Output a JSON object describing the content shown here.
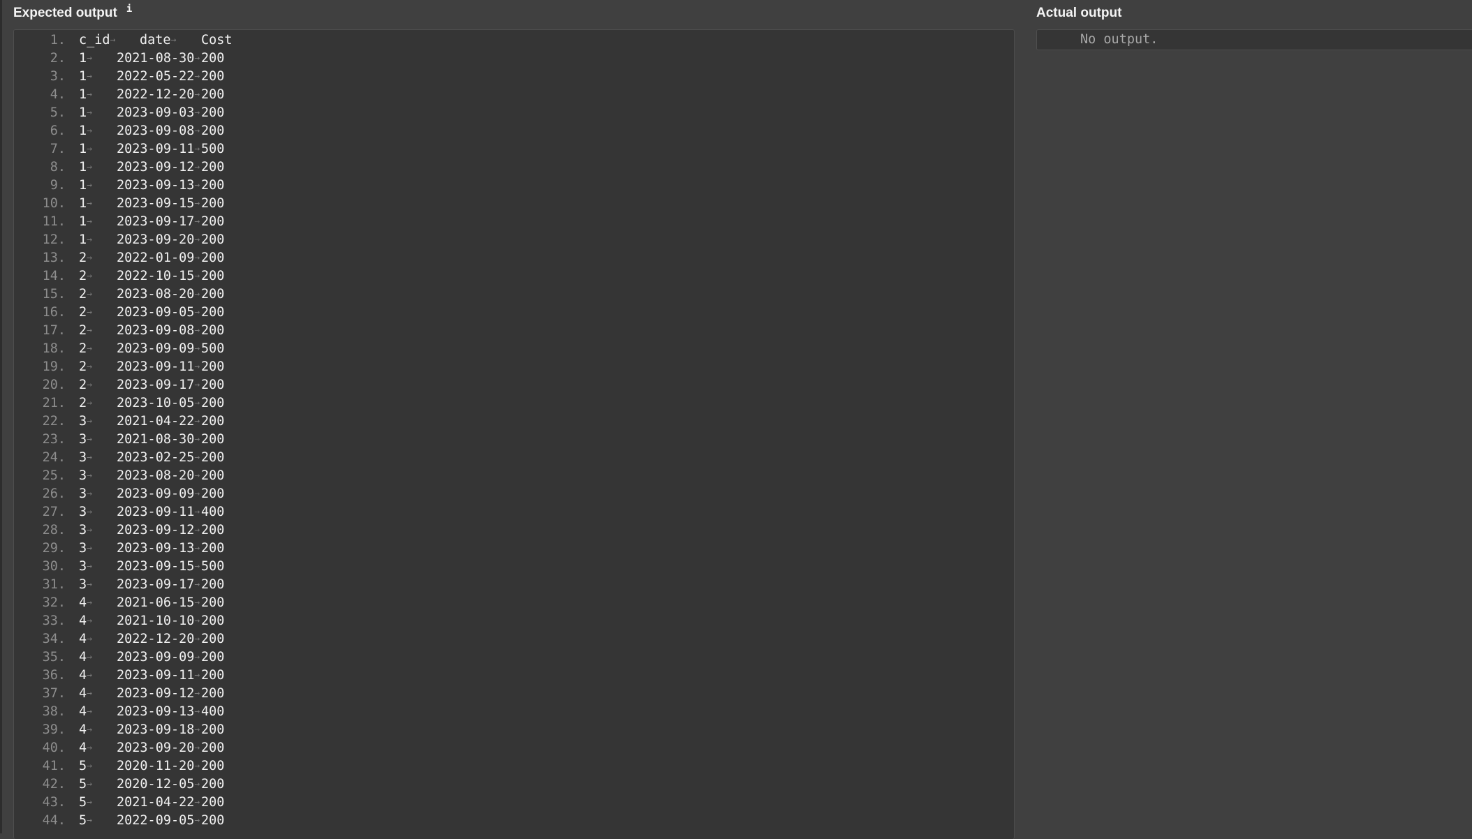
{
  "expected": {
    "title": "Expected output",
    "info_glyph": "i",
    "tab_glyph": "→",
    "columns": [
      "c_id",
      "date",
      "Cost"
    ],
    "rows": [
      [
        "1",
        "2021-08-30",
        "200"
      ],
      [
        "1",
        "2022-05-22",
        "200"
      ],
      [
        "1",
        "2022-12-20",
        "200"
      ],
      [
        "1",
        "2023-09-03",
        "200"
      ],
      [
        "1",
        "2023-09-08",
        "200"
      ],
      [
        "1",
        "2023-09-11",
        "500"
      ],
      [
        "1",
        "2023-09-12",
        "200"
      ],
      [
        "1",
        "2023-09-13",
        "200"
      ],
      [
        "1",
        "2023-09-15",
        "200"
      ],
      [
        "1",
        "2023-09-17",
        "200"
      ],
      [
        "1",
        "2023-09-20",
        "200"
      ],
      [
        "2",
        "2022-01-09",
        "200"
      ],
      [
        "2",
        "2022-10-15",
        "200"
      ],
      [
        "2",
        "2023-08-20",
        "200"
      ],
      [
        "2",
        "2023-09-05",
        "200"
      ],
      [
        "2",
        "2023-09-08",
        "200"
      ],
      [
        "2",
        "2023-09-09",
        "500"
      ],
      [
        "2",
        "2023-09-11",
        "200"
      ],
      [
        "2",
        "2023-09-17",
        "200"
      ],
      [
        "2",
        "2023-10-05",
        "200"
      ],
      [
        "3",
        "2021-04-22",
        "200"
      ],
      [
        "3",
        "2021-08-30",
        "200"
      ],
      [
        "3",
        "2023-02-25",
        "200"
      ],
      [
        "3",
        "2023-08-20",
        "200"
      ],
      [
        "3",
        "2023-09-09",
        "200"
      ],
      [
        "3",
        "2023-09-11",
        "400"
      ],
      [
        "3",
        "2023-09-12",
        "200"
      ],
      [
        "3",
        "2023-09-13",
        "200"
      ],
      [
        "3",
        "2023-09-15",
        "500"
      ],
      [
        "3",
        "2023-09-17",
        "200"
      ],
      [
        "4",
        "2021-06-15",
        "200"
      ],
      [
        "4",
        "2021-10-10",
        "200"
      ],
      [
        "4",
        "2022-12-20",
        "200"
      ],
      [
        "4",
        "2023-09-09",
        "200"
      ],
      [
        "4",
        "2023-09-11",
        "200"
      ],
      [
        "4",
        "2023-09-12",
        "200"
      ],
      [
        "4",
        "2023-09-13",
        "400"
      ],
      [
        "4",
        "2023-09-18",
        "200"
      ],
      [
        "4",
        "2023-09-20",
        "200"
      ],
      [
        "5",
        "2020-11-20",
        "200"
      ],
      [
        "5",
        "2020-12-05",
        "200"
      ],
      [
        "5",
        "2021-04-22",
        "200"
      ],
      [
        "5",
        "2022-09-05",
        "200"
      ]
    ]
  },
  "actual": {
    "title": "Actual output",
    "empty_text": "No output."
  }
}
